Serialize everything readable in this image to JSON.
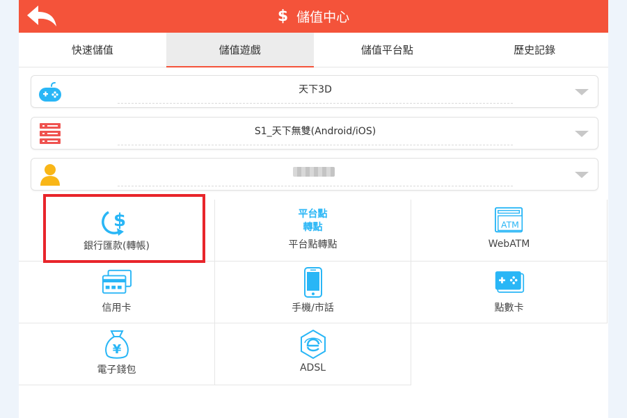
{
  "header": {
    "title": "儲值中心",
    "dollar": "$"
  },
  "tabs": [
    {
      "label": "快速儲值",
      "active": false
    },
    {
      "label": "儲值遊戲",
      "active": true
    },
    {
      "label": "儲值平台點",
      "active": false
    },
    {
      "label": "歷史記錄",
      "active": false
    }
  ],
  "selects": {
    "game": {
      "value": "天下3D",
      "icon": "gamepad-icon"
    },
    "server": {
      "value": "S1_天下無雙(Android/iOS)",
      "icon": "server-icon"
    },
    "account": {
      "value": "",
      "icon": "user-icon"
    }
  },
  "methods": [
    {
      "label": "銀行匯款(轉帳)",
      "icon": "bank-transfer-icon"
    },
    {
      "label": "平台點轉點",
      "icon": "platform-points-icon",
      "icon_text_1": "平台點",
      "icon_text_2": "轉點"
    },
    {
      "label": "WebATM",
      "icon": "atm-icon",
      "icon_text": "ATM"
    },
    {
      "label": "信用卡",
      "icon": "credit-card-icon"
    },
    {
      "label": "手機/市話",
      "icon": "mobile-phone-icon"
    },
    {
      "label": "點數卡",
      "icon": "point-card-icon"
    },
    {
      "label": "電子錢包",
      "icon": "money-bag-icon",
      "icon_text": "¥"
    },
    {
      "label": "ADSL",
      "icon": "adsl-icon"
    }
  ],
  "colors": {
    "accent": "#f4533a",
    "icon_blue": "#29b6f6",
    "highlight": "#e8252b"
  }
}
